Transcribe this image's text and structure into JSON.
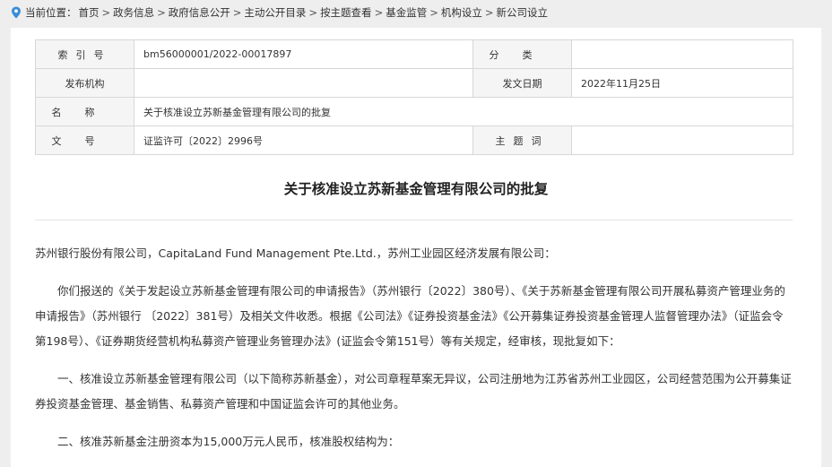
{
  "breadcrumb": {
    "prefix": "当前位置：",
    "items": [
      "首页",
      "政务信息",
      "政府信息公开",
      "主动公开目录",
      "按主题查看",
      "基金监管",
      "机构设立",
      "新公司设立"
    ],
    "separator": ">"
  },
  "meta": {
    "index_label": "索引号",
    "index_value": "bm56000001/2022-00017897",
    "category_label": "分类",
    "category_value": "",
    "issuer_label": "发布机构",
    "issuer_value": "",
    "date_label": "发文日期",
    "date_value": "2022年11月25日",
    "name_label": "名称",
    "name_value": "关于核准设立苏新基金管理有限公司的批复",
    "docno_label": "文号",
    "docno_value": "证监许可〔2022〕2996号",
    "topic_label": "主题词",
    "topic_value": ""
  },
  "document": {
    "title": "关于核准设立苏新基金管理有限公司的批复",
    "addressee": "苏州银行股份有限公司，CapitaLand Fund Management Pte.Ltd.，苏州工业园区经济发展有限公司：",
    "paragraphs": [
      "你们报送的《关于发起设立苏新基金管理有限公司的申请报告》（苏州银行〔2022〕380号）、《关于苏新基金管理有限公司开展私募资产管理业务的申请报告》（苏州银行 〔2022〕381号）及相关文件收悉。根据《公司法》《证券投资基金法》《公开募集证券投资基金管理人监督管理办法》（证监会令第198号）、《证券期货经营机构私募资产管理业务管理办法》(证监会令第151号）等有关规定，经审核，现批复如下：",
      "一、核准设立苏新基金管理有限公司（以下简称苏新基金），对公司章程草案无异议，公司注册地为江苏省苏州工业园区，公司经营范围为公开募集证券投资基金管理、基金销售、私募资产管理和中国证监会许可的其他业务。",
      "二、核准苏新基金注册资本为15,000万元人民币，核准股权结构为："
    ]
  },
  "colors": {
    "background": "#eeeeee",
    "panel": "#ffffff",
    "label_cell": "#f5f5f5",
    "border": "#d7d7d7",
    "pin_icon": "#3a8fd6"
  },
  "icons": {
    "location": "map-pin-icon"
  }
}
